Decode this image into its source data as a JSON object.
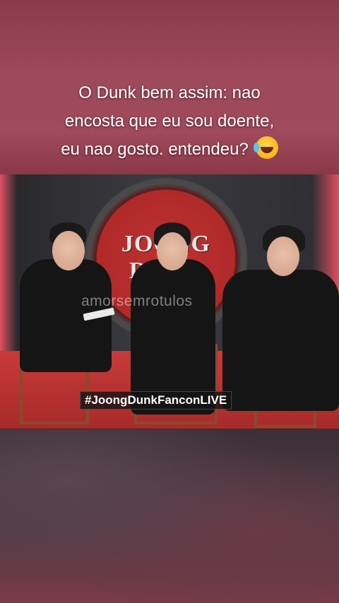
{
  "caption": {
    "line1": "O Dunk bem assim: nao",
    "line2": "encosta que eu sou doente,",
    "line3": "eu nao gosto. entendeu?",
    "emoji": "rolling-on-floor-laughing-emoji"
  },
  "video": {
    "logo_text": "JOONG DUNK",
    "watermark": "amorsemrotulos",
    "hashtag": "#JoongDunkFanconLIVE"
  },
  "colors": {
    "background": "#8a3a4a",
    "backdrop_red": "#c03030",
    "text": "#ffffff"
  }
}
